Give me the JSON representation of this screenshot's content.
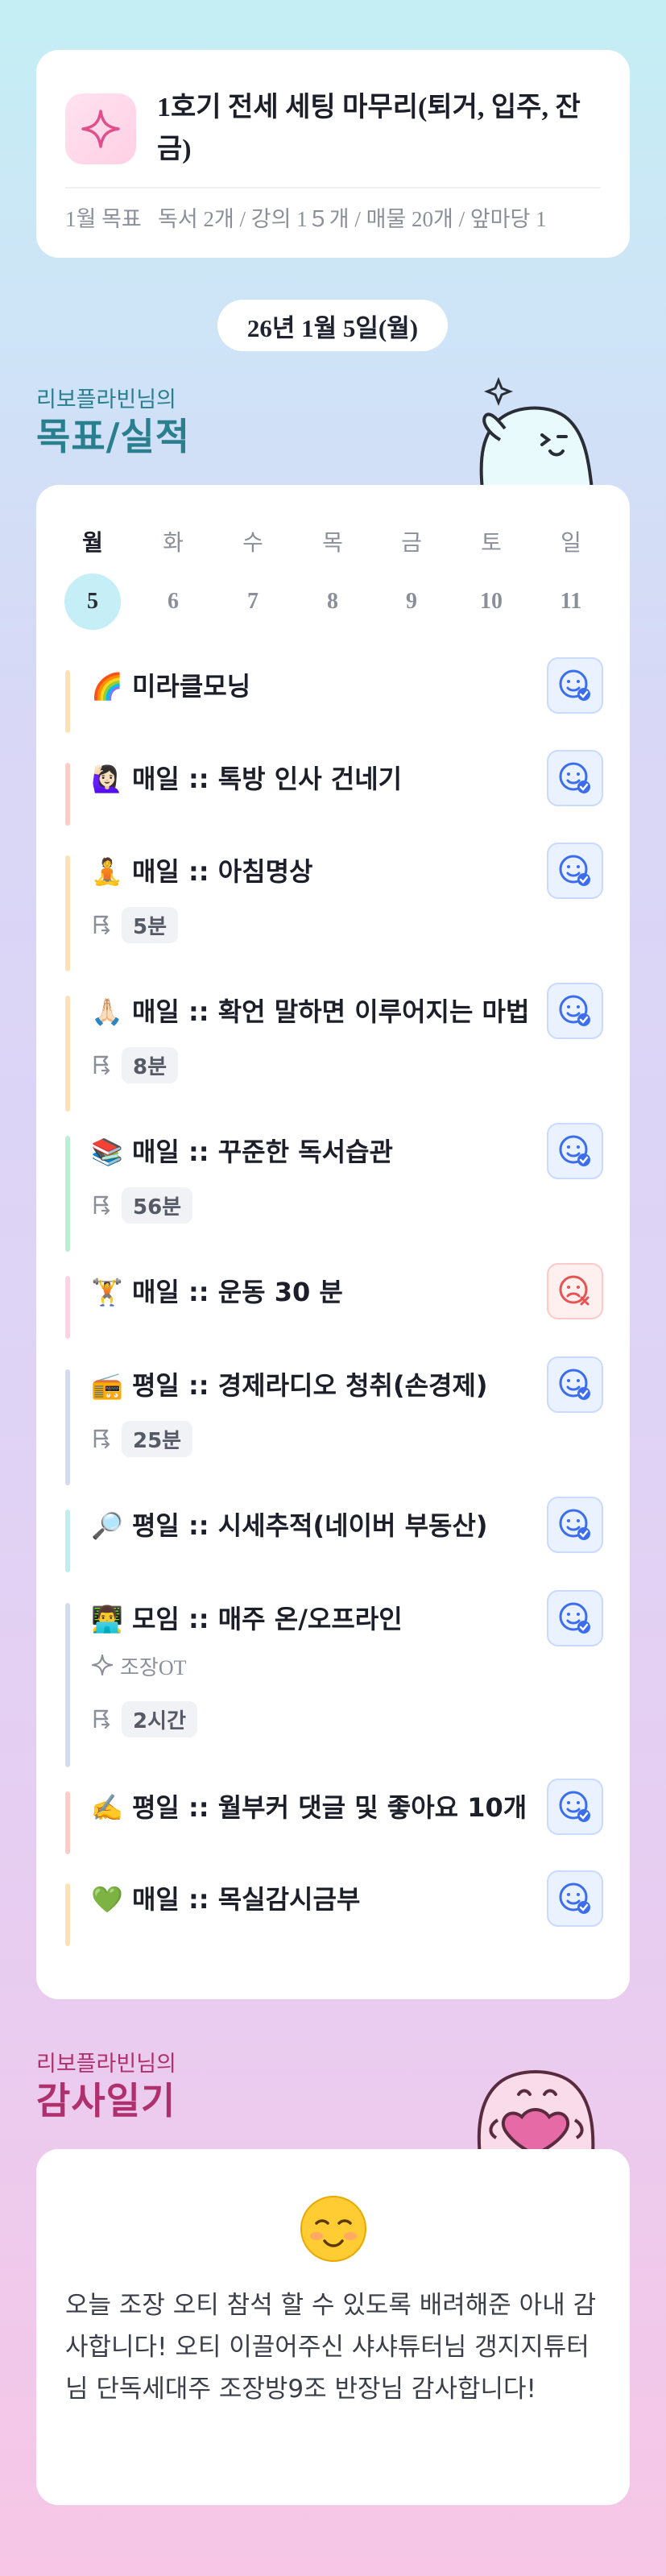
{
  "goal": {
    "title": "1호기 전세 세팅 마무리(퇴거, 입주, 잔금)",
    "month_label": "1월 목표",
    "summary": "독서 2개 / 강의 1５개 / 매물 20개 / 앞마당 1"
  },
  "date": "26년 1월 5일(월)",
  "goals_section": {
    "subtitle": "리보플라빈님의",
    "title": "목표/실적"
  },
  "week": {
    "days": [
      "월",
      "화",
      "수",
      "목",
      "금",
      "토",
      "일"
    ],
    "dates": [
      "5",
      "6",
      "7",
      "8",
      "9",
      "10",
      "11"
    ],
    "selected_index": 0
  },
  "tasks": [
    {
      "emoji": "🌈",
      "title": "미라클모닝",
      "status": "done",
      "bar": "#ffe1b8"
    },
    {
      "emoji": "🙋🏻‍♀️",
      "title": "매일 :: 톡방 인사 건네기",
      "status": "done",
      "bar": "#ffcdc5"
    },
    {
      "emoji": "🧘",
      "title": "매일 :: 아침명상",
      "status": "done",
      "bar": "#ffe1b8",
      "duration": "5분"
    },
    {
      "emoji": "🙏🏻",
      "title": "매일 :: 확언 말하면 이루어지는 마법",
      "status": "done",
      "bar": "#ffe1b8",
      "duration": "8분"
    },
    {
      "emoji": "📚",
      "title": "매일 :: 꾸준한 독서습관",
      "status": "done",
      "bar": "#bdeed6",
      "duration": "56분"
    },
    {
      "emoji": "🏋",
      "title": "매일 :: 운동 30 분",
      "status": "fail",
      "bar": "#ffd3e4"
    },
    {
      "emoji": "📻",
      "title": "평일 :: 경제라디오 청취(손경제)",
      "status": "done",
      "bar": "#d5dcf2",
      "duration": "25분"
    },
    {
      "emoji": "🔎",
      "title": "평일 :: 시세추적(네이버 부동산)",
      "status": "done",
      "bar": "#c3ecf0"
    },
    {
      "emoji": "👨‍💻",
      "title": "모임 :: 매주 온/오프라인",
      "status": "done",
      "bar": "#d5dcf2",
      "note": "조장OT",
      "duration": "2시간"
    },
    {
      "emoji": "✍️",
      "title": "평일 :: 월부커 댓글 및 좋아요 10개",
      "status": "done",
      "bar": "#ffcdc5"
    },
    {
      "emoji": "💚",
      "title": "매일 :: 목실감시금부",
      "status": "done",
      "bar": "#ffe1b8"
    }
  ],
  "gratitude_section": {
    "subtitle": "리보플라빈님의",
    "title": "감사일기"
  },
  "gratitude": {
    "text": "오늘 조장 오티 참석 할 수 있도록 배려해준 아내 감사합니다! 오티 이끌어주신 샤샤튜터님 갱지지튜터님 단독세대주 조장방9조 반장님 감사합니다!"
  },
  "colors": {
    "goal_title_color": "#2a7f8f",
    "grat_title_color": "#b0306e",
    "ok_icon": "#3b6df0",
    "fail_icon": "#e55353"
  }
}
